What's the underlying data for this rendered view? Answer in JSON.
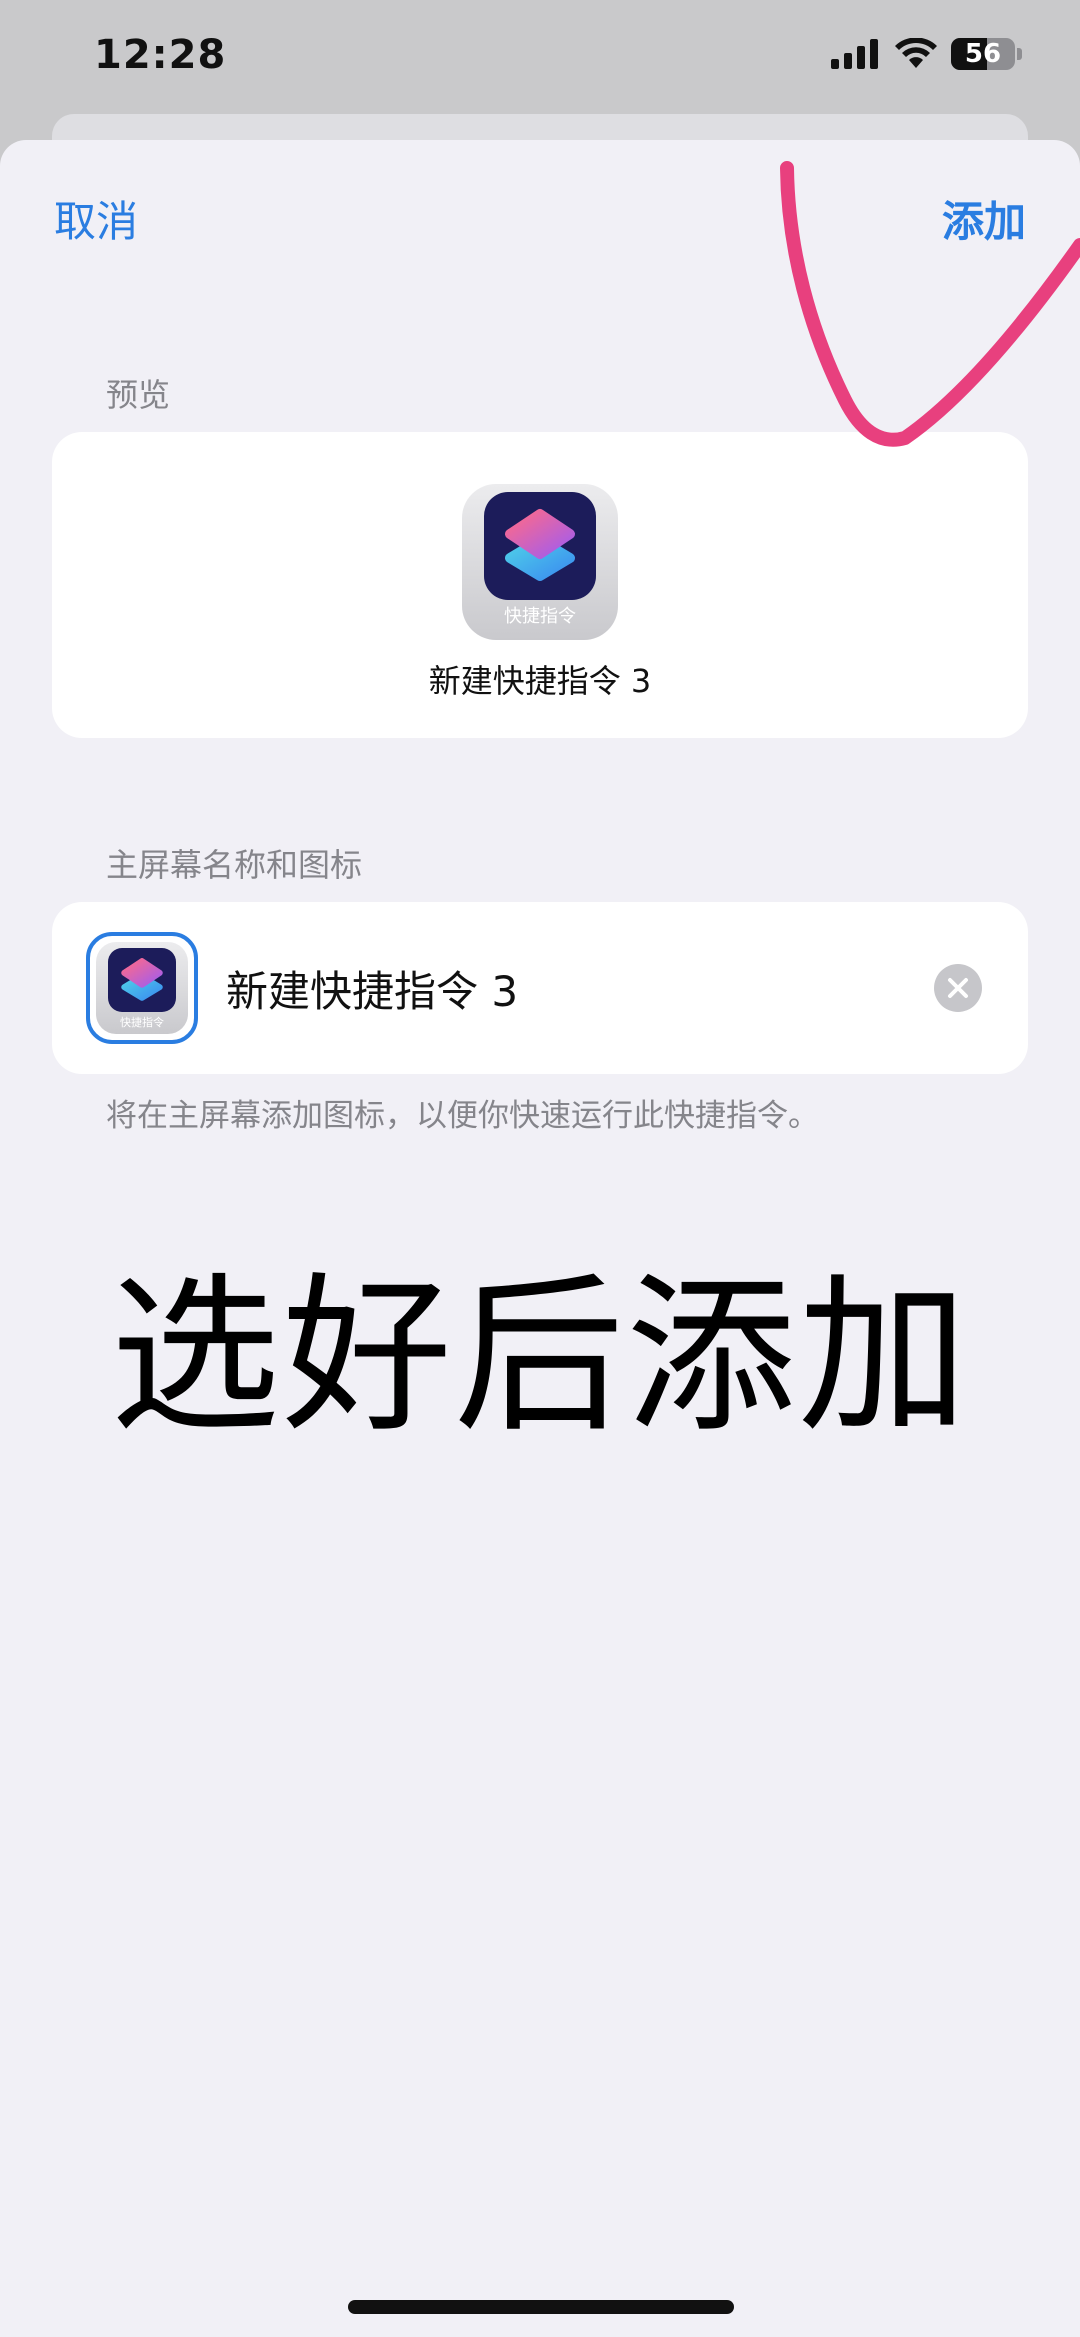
{
  "status_bar": {
    "time": "12:28",
    "battery_level": "56",
    "battery_fraction": 0.56,
    "icons": [
      "cellular-signal-icon",
      "wifi-icon",
      "battery-icon"
    ]
  },
  "nav": {
    "cancel_label": "取消",
    "add_label": "添加"
  },
  "preview": {
    "section_label": "预览",
    "icon_caption": "快捷指令",
    "shortcut_name": "新建快捷指令 3"
  },
  "home_screen": {
    "section_label": "主屏幕名称和图标",
    "icon_caption": "快捷指令",
    "name_value": "新建快捷指令 3",
    "hint": "将在主屏幕添加图标，以便你快速运行此快捷指令。"
  },
  "annotation": {
    "overlay_text": "选好后添加"
  },
  "colors": {
    "accent": "#2a7de1",
    "sheet_background": "#f1f0f6",
    "annotation_stroke": "#e8407e"
  }
}
